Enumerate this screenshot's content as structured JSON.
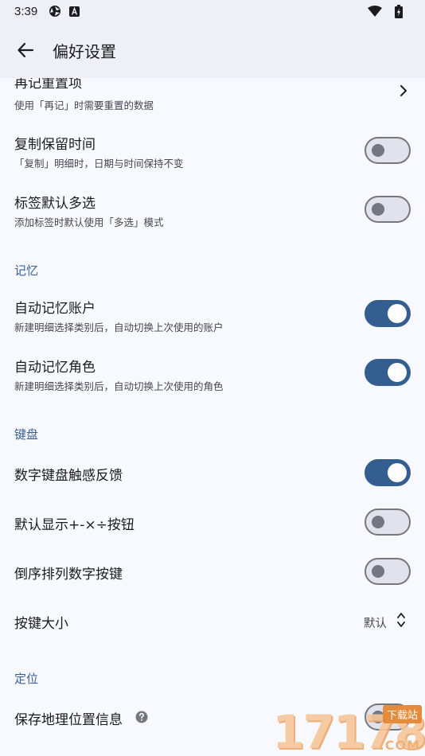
{
  "status_bar": {
    "time": "3:39",
    "icons": [
      "camera-shutter-icon",
      "font-a-icon",
      "wifi-icon",
      "battery-charging-icon"
    ]
  },
  "app_bar": {
    "back_icon": "arrow-left-icon",
    "title": "偏好设置"
  },
  "rows": {
    "reset_item": {
      "title": "再记重置项",
      "subtitle": "使用「再记」时需要重置的数据"
    },
    "copy_keep_time": {
      "title": "复制保留时间",
      "subtitle": "「复制」明细时，日期与时间保持不变",
      "enabled": false
    },
    "tag_multi_select": {
      "title": "标签默认多选",
      "subtitle": "添加标签时默认使用「多选」模式",
      "enabled": false
    },
    "auto_remember_account": {
      "title": "自动记忆账户",
      "subtitle": "新建明细选择类别后，自动切换上次使用的账户",
      "enabled": true
    },
    "auto_remember_role": {
      "title": "自动记忆角色",
      "subtitle": "新建明细选择类别后，自动切换上次使用的角色",
      "enabled": true
    },
    "numpad_haptic": {
      "title": "数字键盘触感反馈",
      "enabled": true
    },
    "show_operators": {
      "title": "默认显示+-×÷按钮",
      "enabled": false
    },
    "reverse_numpad": {
      "title": "倒序排列数字按键",
      "enabled": false
    },
    "key_size": {
      "title": "按键大小",
      "value": "默认"
    },
    "save_location": {
      "title": "保存地理位置信息",
      "enabled": false
    }
  },
  "sections": {
    "memory": "记忆",
    "keyboard": "键盘",
    "location": "定位"
  },
  "colors": {
    "accent": "#345e8f",
    "section_header": "#3a5f93",
    "switch_off_track": "#e1e2ec",
    "switch_off_outline": "#74777f",
    "app_bar_bg": "#eef0f7",
    "page_bg": "#f8f9ff"
  },
  "watermark": {
    "text": "17178",
    "badge": "下载站",
    "suffix": ".COM"
  }
}
